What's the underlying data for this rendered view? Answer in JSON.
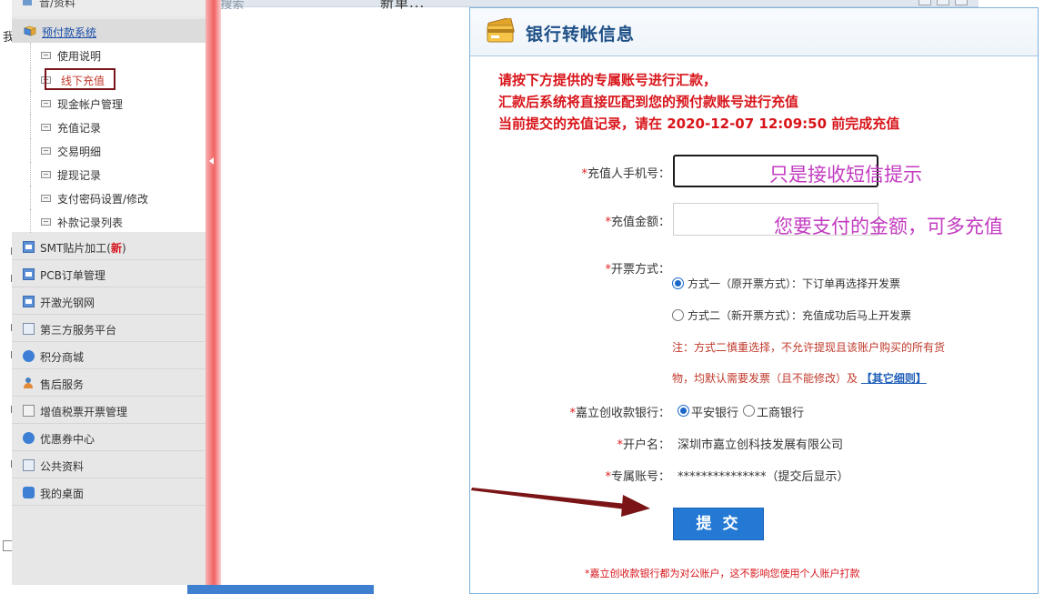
{
  "background": {
    "search_fragment": "Q 搜索",
    "title_fragment": "新单...",
    "left_char": "我"
  },
  "sidebar": {
    "top_partial_label": "音/资料",
    "open_group": {
      "label": "预付款系统",
      "icon": "folder-icon"
    },
    "submenu": [
      {
        "label": "使用说明",
        "selected": false
      },
      {
        "label": "线下充值",
        "selected": true
      },
      {
        "label": "现金帐户管理",
        "selected": false
      },
      {
        "label": "充值记录",
        "selected": false
      },
      {
        "label": "交易明细",
        "selected": false
      },
      {
        "label": "提现记录",
        "selected": false
      },
      {
        "label": "支付密码设置/修改",
        "selected": false
      },
      {
        "label": "补款记录列表",
        "selected": false
      }
    ],
    "groups": [
      {
        "label": "SMT贴片加工(",
        "badge": "新",
        "suffix": ")",
        "icon": "window-icon"
      },
      {
        "label": "PCB订单管理",
        "icon": "window-icon"
      },
      {
        "label": "开激光钢网",
        "icon": "window-icon"
      },
      {
        "label": "第三方服务平台",
        "icon": "screen-icon"
      },
      {
        "label": "积分商城",
        "icon": "globe-icon"
      },
      {
        "label": "售后服务",
        "icon": "person-icon"
      },
      {
        "label": "增值税票开票管理",
        "icon": "document-icon"
      },
      {
        "label": "优惠券中心",
        "icon": "globe-icon"
      },
      {
        "label": "公共资料",
        "icon": "screen-icon"
      },
      {
        "label": "我的桌面",
        "icon": "chat-icon"
      }
    ]
  },
  "dialog": {
    "title": "银行转帐信息",
    "notice_lines": [
      "请按下方提供的专属账号进行汇款，",
      "汇款后系统将直接匹配到您的预付款账号进行充值",
      "当前提交的充值记录，请在 2020-12-07 12:09:50 前完成充值"
    ],
    "phone": {
      "label": "充值人手机号：",
      "value": "",
      "hint": "只是接收短信提示"
    },
    "amount": {
      "label": "充值金额：",
      "value": "",
      "hint": "您要支付的金额，可多充值"
    },
    "invoice": {
      "label": "开票方式：",
      "options": [
        {
          "text": "方式一（原开票方式）：下订单再选择开发票",
          "checked": true
        },
        {
          "text": "方式二（新开票方式）：充值成功后马上开发票",
          "checked": false
        }
      ],
      "warning_line1": "注：方式二慎重选择，不允许提现且该账户购买的所有货",
      "warning_line2": "物，均默认需要发票（且不能修改）及",
      "warning_link": "【其它细则】"
    },
    "bank": {
      "label": "嘉立创收款银行：",
      "options": [
        {
          "text": "平安银行",
          "checked": true
        },
        {
          "text": "工商银行",
          "checked": false
        }
      ]
    },
    "account_name": {
      "label": "开户名：",
      "value": "深圳市嘉立创科技发展有限公司"
    },
    "account_number": {
      "label": "专属账号：",
      "value": "***************（提交后显示）"
    },
    "submit_label": "提 交",
    "footnote": "*嘉立创收款银行都为对公账户，这不影响您使用个人账户打款",
    "required_mark": "*"
  },
  "colors": {
    "notice_red": "#d8141a",
    "hint_magenta": "#c23bc0",
    "submit_blue": "#2479d4",
    "title_blue": "#1d4f86",
    "annotation_arrow": "#7b1416"
  }
}
